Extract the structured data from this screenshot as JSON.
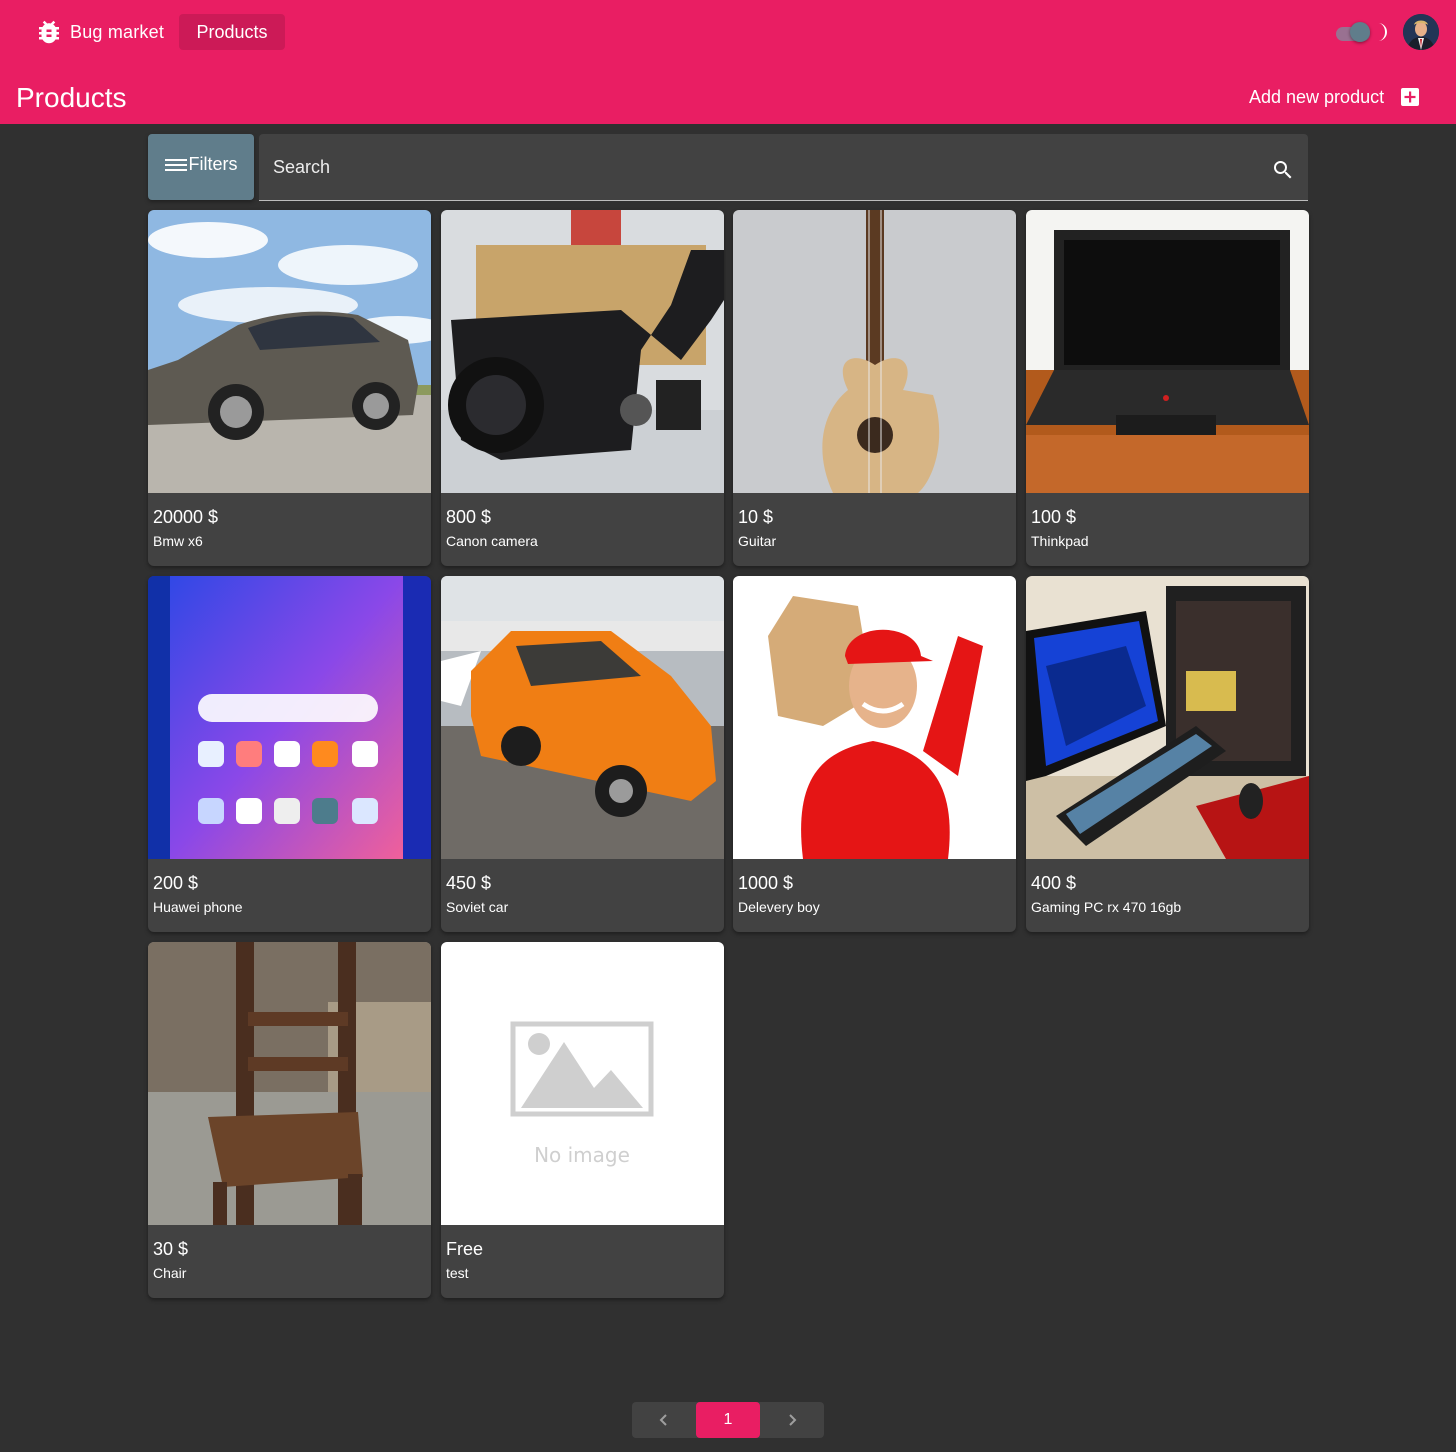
{
  "header": {
    "brand_label": "Bug market",
    "nav_products_label": "Products",
    "theme": {
      "dark_mode_enabled": true,
      "icon": "moon-icon"
    },
    "avatar_icon": "user-avatar",
    "page_title": "Products",
    "add_product_label": "Add new product",
    "accent_color": "#e91e63"
  },
  "toolbar": {
    "filters_label": "Filters",
    "search_placeholder": "Search",
    "search_value": ""
  },
  "products": [
    {
      "price": "20000 $",
      "name": "Bmw x6",
      "image": "photo-suv"
    },
    {
      "price": "800 $",
      "name": "Canon camera",
      "image": "photo-camcorder"
    },
    {
      "price": "10 $",
      "name": "Guitar",
      "image": "photo-guitar"
    },
    {
      "price": "100 $",
      "name": "Thinkpad",
      "image": "photo-laptop"
    },
    {
      "price": "200 $",
      "name": "Huawei phone",
      "image": "photo-phone"
    },
    {
      "price": "450 $",
      "name": "Soviet car",
      "image": "photo-orange-car"
    },
    {
      "price": "1000 $",
      "name": "Delevery boy",
      "image": "photo-courier"
    },
    {
      "price": "400 $",
      "name": "Gaming PC rx 470 16gb",
      "image": "photo-gaming-pc"
    },
    {
      "price": "30 $",
      "name": "Chair",
      "image": "photo-chair"
    },
    {
      "price": "Free",
      "name": "test",
      "image": "placeholder-no-image",
      "placeholder_text": "No image"
    }
  ],
  "pagination": {
    "current_page": "1"
  }
}
